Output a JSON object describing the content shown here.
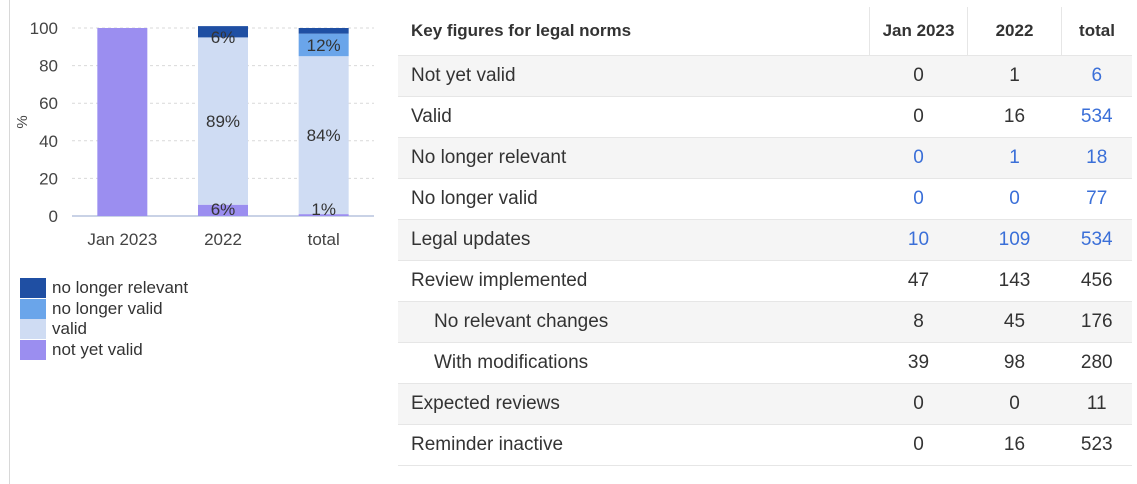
{
  "chart_data": {
    "type": "bar",
    "stacked": true,
    "ylabel": "%",
    "ylim": [
      0,
      100
    ],
    "yticks": [
      0,
      20,
      40,
      60,
      80,
      100
    ],
    "categories": [
      "Jan 2023",
      "2022",
      "total"
    ],
    "grid": true,
    "series": [
      {
        "name": "not yet valid",
        "values": [
          100,
          6,
          1
        ],
        "color": "#9b8ef0"
      },
      {
        "name": "valid",
        "values": [
          0,
          89,
          84
        ],
        "color": "#cfdcf3"
      },
      {
        "name": "no longer valid",
        "values": [
          0,
          0,
          12
        ],
        "color": "#6aa5ea"
      },
      {
        "name": "no longer relevant",
        "values": [
          0,
          6,
          3
        ],
        "color": "#1f4fa3"
      }
    ],
    "data_labels": [
      {
        "category": "2022",
        "series": "not yet valid",
        "text": "6%"
      },
      {
        "category": "2022",
        "series": "valid",
        "text": "89%"
      },
      {
        "category": "2022",
        "series": "no longer relevant",
        "text": "6%"
      },
      {
        "category": "total",
        "series": "not yet valid",
        "text": "1%"
      },
      {
        "category": "total",
        "series": "valid",
        "text": "84%"
      },
      {
        "category": "total",
        "series": "no longer valid",
        "text": "12%"
      }
    ],
    "legend": [
      {
        "label": "no longer relevant",
        "color": "#1f4fa3"
      },
      {
        "label": "no longer valid",
        "color": "#6aa5ea"
      },
      {
        "label": "valid",
        "color": "#cfdcf3"
      },
      {
        "label": "not yet valid",
        "color": "#9b8ef0"
      }
    ],
    "legend_position": "bottom-left"
  },
  "table": {
    "title": "Key figures for legal norms",
    "columns": [
      "Jan 2023",
      "2022",
      "total"
    ],
    "rows": [
      {
        "label": "Not yet valid",
        "values": [
          "0",
          "1",
          "6"
        ],
        "links": [
          false,
          false,
          true
        ],
        "shaded": true,
        "indent": false
      },
      {
        "label": "Valid",
        "values": [
          "0",
          "16",
          "534"
        ],
        "links": [
          false,
          false,
          true
        ],
        "shaded": false,
        "indent": false
      },
      {
        "label": "No longer relevant",
        "values": [
          "0",
          "1",
          "18"
        ],
        "links": [
          true,
          true,
          true
        ],
        "shaded": true,
        "indent": false
      },
      {
        "label": "No longer valid",
        "values": [
          "0",
          "0",
          "77"
        ],
        "links": [
          true,
          true,
          true
        ],
        "shaded": false,
        "indent": false
      },
      {
        "label": "Legal updates",
        "values": [
          "10",
          "109",
          "534"
        ],
        "links": [
          true,
          true,
          true
        ],
        "shaded": true,
        "indent": false
      },
      {
        "label": "Review implemented",
        "values": [
          "47",
          "143",
          "456"
        ],
        "links": [
          false,
          false,
          false
        ],
        "shaded": false,
        "indent": false
      },
      {
        "label": "No relevant changes",
        "values": [
          "8",
          "45",
          "176"
        ],
        "links": [
          false,
          false,
          false
        ],
        "shaded": true,
        "indent": true
      },
      {
        "label": "With modifications",
        "values": [
          "39",
          "98",
          "280"
        ],
        "links": [
          false,
          false,
          false
        ],
        "shaded": false,
        "indent": true
      },
      {
        "label": "Expected reviews",
        "values": [
          "0",
          "0",
          "11"
        ],
        "links": [
          false,
          false,
          false
        ],
        "shaded": true,
        "indent": false
      },
      {
        "label": "Reminder inactive",
        "values": [
          "0",
          "16",
          "523"
        ],
        "links": [
          false,
          false,
          false
        ],
        "shaded": false,
        "indent": false
      }
    ]
  },
  "colors": {
    "link": "#3a6fd8"
  }
}
